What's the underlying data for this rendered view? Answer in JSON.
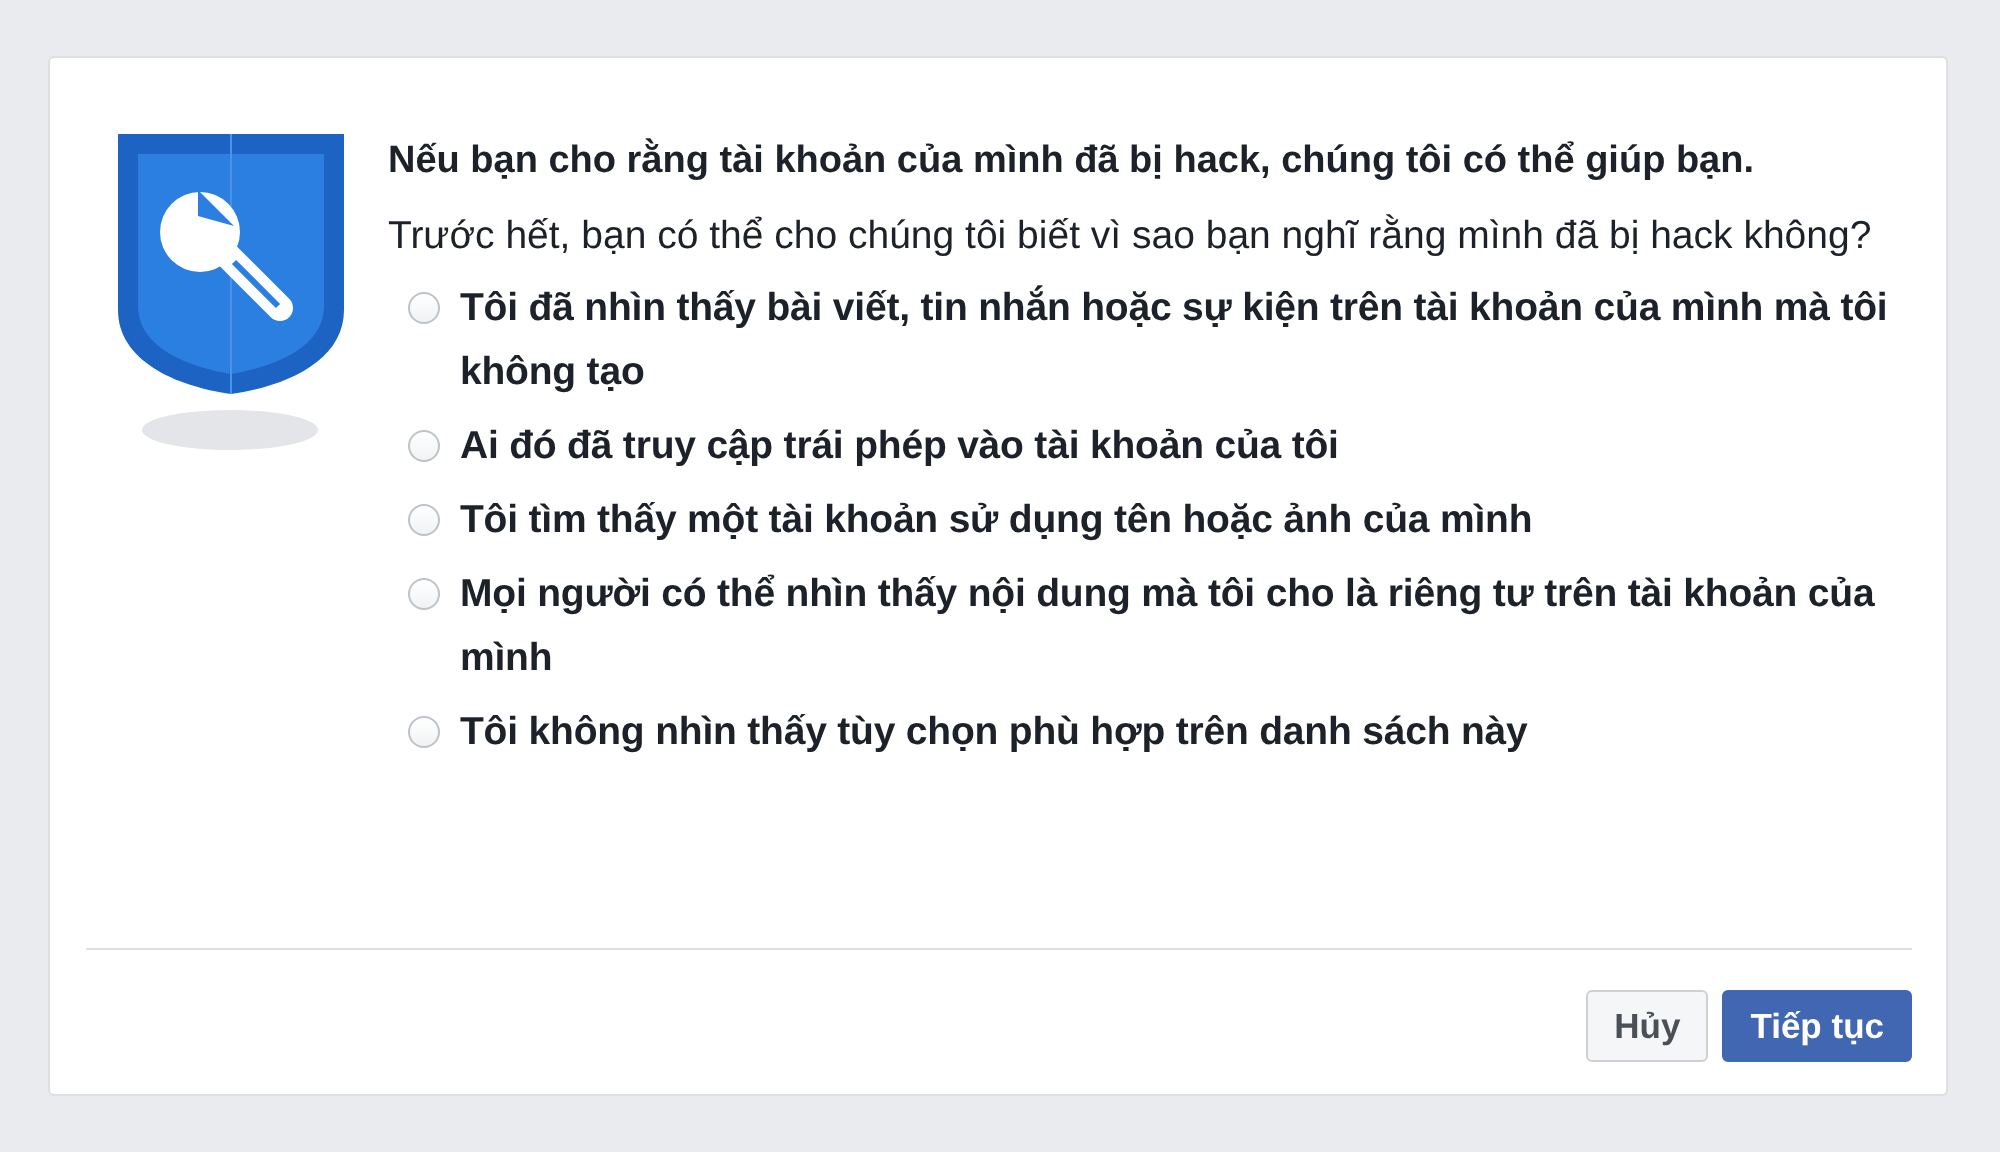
{
  "dialog": {
    "title": "Nếu bạn cho rằng tài khoản của mình đã bị hack, chúng tôi có thể giúp bạn.",
    "question": "Trước hết, bạn có thể cho chúng tôi biết vì sao bạn nghĩ rằng mình đã bị hack không?",
    "options": [
      {
        "label": "Tôi đã nhìn thấy bài viết, tin nhắn hoặc sự kiện trên tài khoản của mình mà tôi không tạo",
        "selected": false
      },
      {
        "label": "Ai đó đã truy cập trái phép vào tài khoản của tôi",
        "selected": false
      },
      {
        "label": "Tôi tìm thấy một tài khoản sử dụng tên hoặc ảnh của mình",
        "selected": false
      },
      {
        "label": "Mọi người có thể nhìn thấy nội dung mà tôi cho là riêng tư trên tài khoản của mình",
        "selected": false
      },
      {
        "label": "Tôi không nhìn thấy tùy chọn phù hợp trên danh sách này",
        "selected": false
      }
    ],
    "buttons": [
      {
        "label": "Hủy",
        "kind": "secondary"
      },
      {
        "label": "Tiếp tục",
        "kind": "primary"
      }
    ]
  }
}
